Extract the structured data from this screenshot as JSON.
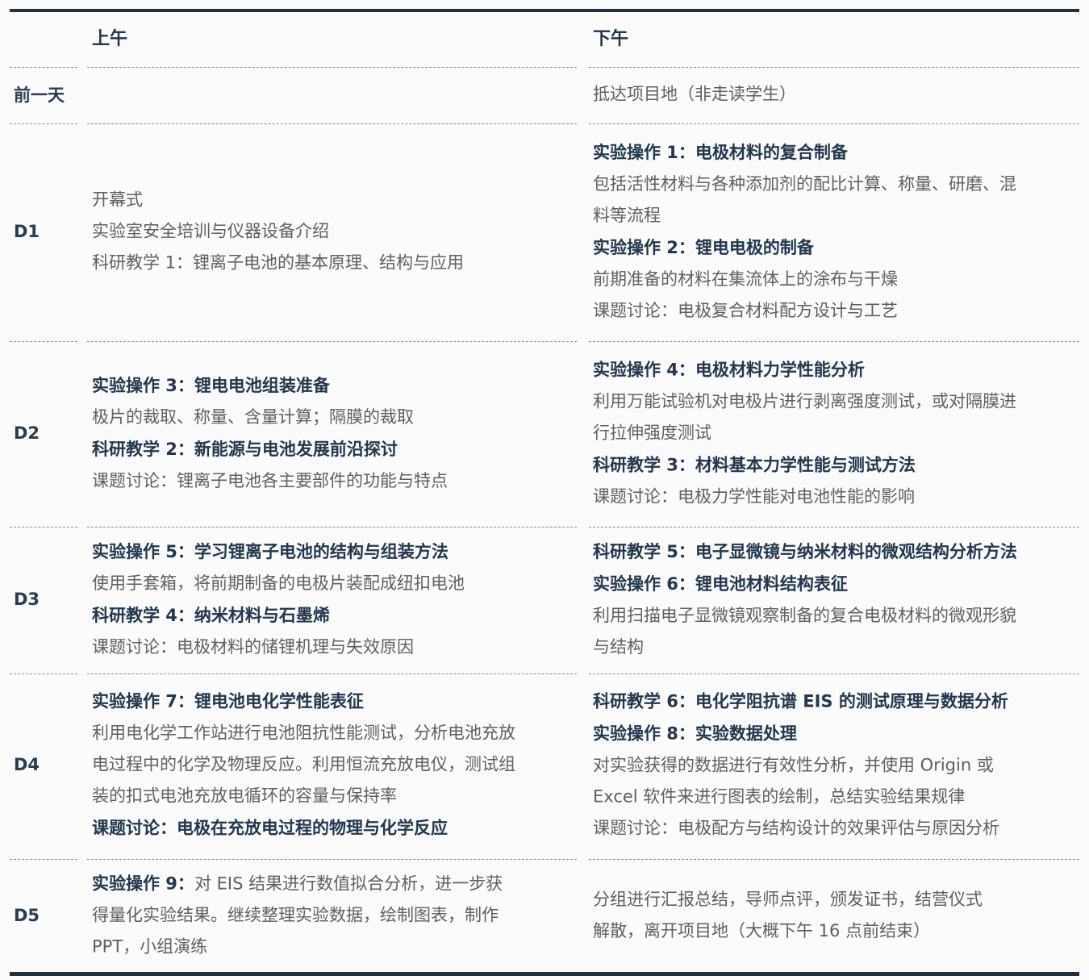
{
  "header": {
    "morning": "上午",
    "afternoon": "下午"
  },
  "rows": [
    {
      "label": "前一天",
      "am": [],
      "pm": [
        {
          "text": "抵达项目地（非走读学生）"
        }
      ]
    },
    {
      "label": "D1",
      "am": [
        {
          "text": "开幕式"
        },
        {
          "text": "实验室安全培训与仪器设备介绍"
        },
        {
          "text": "科研教学 1：锂离子电池的基本原理、结构与应用"
        }
      ],
      "pm": [
        {
          "text": "实验操作 1：电极材料的复合制备",
          "bold": true
        },
        {
          "text": "包括活性材料与各种添加剂的配比计算、称量、研磨、混"
        },
        {
          "text": "料等流程"
        },
        {
          "text": "实验操作 2：锂电电极的制备",
          "bold": true
        },
        {
          "text": "前期准备的材料在集流体上的涂布与干燥"
        },
        {
          "text": "课题讨论：电极复合材料配方设计与工艺"
        }
      ]
    },
    {
      "label": "D2",
      "am": [
        {
          "text": "实验操作 3：锂电电池组装准备",
          "bold": true
        },
        {
          "text": "极片的裁取、称量、含量计算；隔膜的裁取"
        },
        {
          "text": "科研教学 2：新能源与电池发展前沿探讨",
          "bold": true
        },
        {
          "text": "课题讨论：锂离子电池各主要部件的功能与特点"
        }
      ],
      "pm": [
        {
          "text": "实验操作 4：电极材料力学性能分析",
          "bold": true
        },
        {
          "text": "利用万能试验机对电极片进行剥离强度测试，或对隔膜进"
        },
        {
          "text": "行拉伸强度测试"
        },
        {
          "text": "科研教学 3：材料基本力学性能与测试方法",
          "bold": true
        },
        {
          "text": "课题讨论：电极力学性能对电池性能的影响"
        }
      ]
    },
    {
      "label": "D3",
      "am": [
        {
          "text": "实验操作 5：学习锂离子电池的结构与组装方法",
          "bold": true
        },
        {
          "text": "使用手套箱，将前期制备的电极片装配成纽扣电池"
        },
        {
          "text": "科研教学 4：纳米材料与石墨烯",
          "bold": true
        },
        {
          "text": "课题讨论：电极材料的储锂机理与失效原因"
        }
      ],
      "pm": [
        {
          "text": "科研教学 5：电子显微镜与纳米材料的微观结构分析方法",
          "bold": true
        },
        {
          "text": "实验操作 6：锂电池材料结构表征",
          "bold": true
        },
        {
          "text": "利用扫描电子显微镜观察制备的复合电极材料的微观形貌"
        },
        {
          "text": "与结构"
        }
      ]
    },
    {
      "label": "D4",
      "am": [
        {
          "text": "实验操作 7：锂电池电化学性能表征",
          "bold": true
        },
        {
          "text": "利用电化学工作站进行电池阻抗性能测试，分析电池充放"
        },
        {
          "text": "电过程中的化学及物理反应。利用恒流充放电仪，测试组"
        },
        {
          "text": "装的扣式电池充放电循环的容量与保持率"
        },
        {
          "text": "课题讨论：电极在充放电过程的物理与化学反应",
          "bold": true
        }
      ],
      "pm": [
        {
          "text": "科研教学 6：电化学阻抗谱 EIS 的测试原理与数据分析",
          "bold": true
        },
        {
          "text": "实验操作 8：实验数据处理",
          "bold": true
        },
        {
          "text": "对实验获得的数据进行有效性分析，并使用 Origin 或"
        },
        {
          "text": "Excel 软件来进行图表的绘制，总结实验结果规律"
        },
        {
          "text": "课题讨论：电极配方与结构设计的效果评估与原因分析"
        }
      ]
    },
    {
      "label": "D5",
      "am": [
        {
          "lead": "实验操作 9：",
          "text": "对 EIS 结果进行数值拟合分析，进一步获"
        },
        {
          "text": "得量化实验结果。继续整理实验数据，绘制图表，制作"
        },
        {
          "text": "PPT，小组演练"
        }
      ],
      "pm": [
        {
          "text": "分组进行汇报总结，导师点评，颁发证书，结营仪式"
        },
        {
          "text": "解散，离开项目地（大概下午 16 点前结束）"
        }
      ]
    }
  ]
}
